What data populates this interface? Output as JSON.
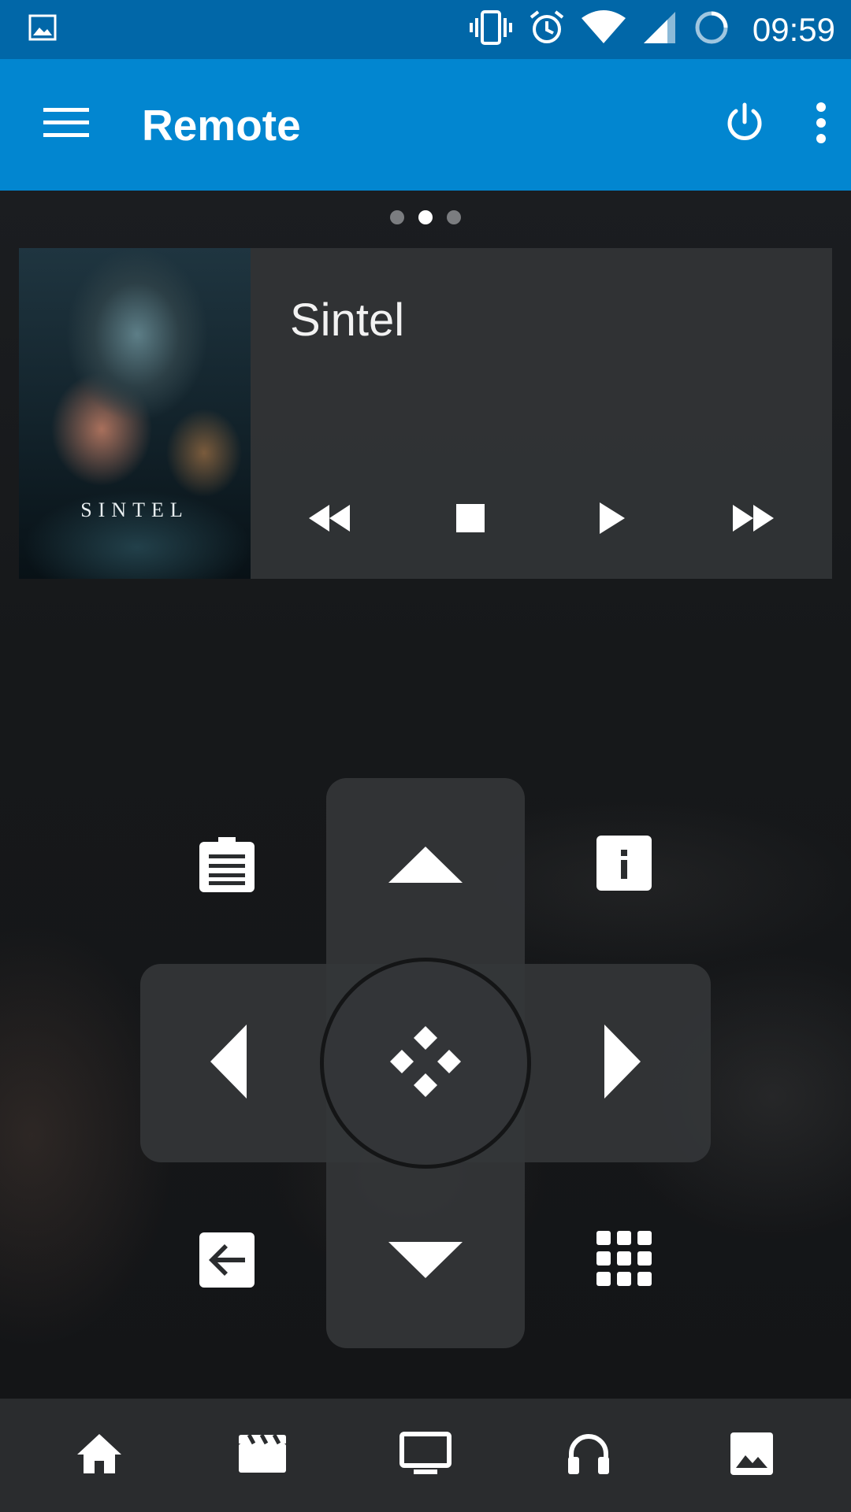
{
  "status_bar": {
    "time": "09:59",
    "icons": [
      "image-notification-icon",
      "vibrate-icon",
      "alarm-icon",
      "wifi-icon",
      "signal-icon",
      "sync-icon"
    ]
  },
  "app_bar": {
    "title": "Remote",
    "actions": [
      "menu-icon",
      "power-icon",
      "more-vert-icon"
    ],
    "background": "#0286d0",
    "status_background": "#0167a8"
  },
  "pager": {
    "count": 3,
    "active_index": 1
  },
  "now_playing": {
    "title": "Sintel",
    "poster_text": "SINTEL",
    "controls": [
      "rewind-icon",
      "stop-icon",
      "play-icon",
      "fast-forward-icon"
    ]
  },
  "dpad": {
    "buttons": [
      "up-arrow-icon",
      "down-arrow-icon",
      "left-arrow-icon",
      "right-arrow-icon",
      "select-icon"
    ],
    "corners": [
      "context-menu-icon",
      "info-icon",
      "back-icon",
      "osd-grid-icon"
    ]
  },
  "bottom_nav": {
    "items": [
      "home-icon",
      "movies-icon",
      "tv-icon",
      "music-icon",
      "pictures-icon"
    ],
    "background": "#2a2c2e"
  }
}
